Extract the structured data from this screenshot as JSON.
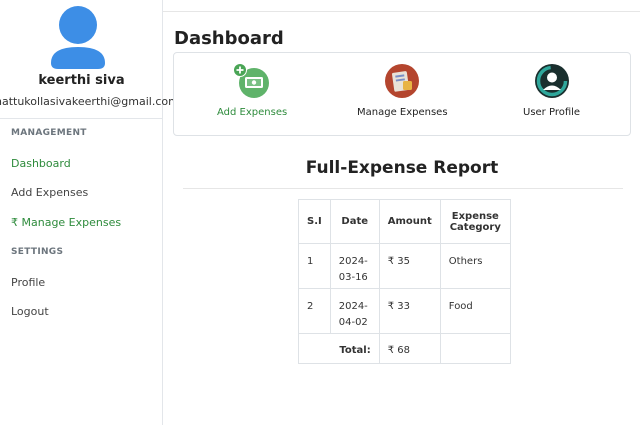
{
  "sidebar": {
    "user": {
      "name": "keerthi siva",
      "email": "hattukollasivakeerthi@gmail.com"
    },
    "sections": [
      {
        "heading": "MANAGEMENT"
      },
      {
        "heading": "SETTINGS"
      }
    ],
    "links": {
      "dashboard": "Dashboard",
      "add_expenses": "Add Expenses",
      "manage_expenses": "₹ Manage Expenses",
      "profile": "Profile",
      "logout": "Logout"
    },
    "accent_color": "#2e8b3c"
  },
  "main": {
    "title": "Dashboard",
    "actions": [
      {
        "label": "Add Expenses",
        "icon": "money-add-icon"
      },
      {
        "label": "Manage Expenses",
        "icon": "ledger-icon"
      },
      {
        "label": "User Profile",
        "icon": "user-profile-icon"
      }
    ],
    "report": {
      "title": "Full-Expense Report",
      "headers": [
        "S.I",
        "Date",
        "Amount",
        "Expense Category"
      ],
      "rows": [
        {
          "si": "1",
          "date": "2024-03-16",
          "amount": "₹ 35",
          "category": "Others"
        },
        {
          "si": "2",
          "date": "2024-04-02",
          "amount": "₹ 33",
          "category": "Food"
        }
      ],
      "total_label": "Total:",
      "total_value": "₹ 68"
    }
  }
}
